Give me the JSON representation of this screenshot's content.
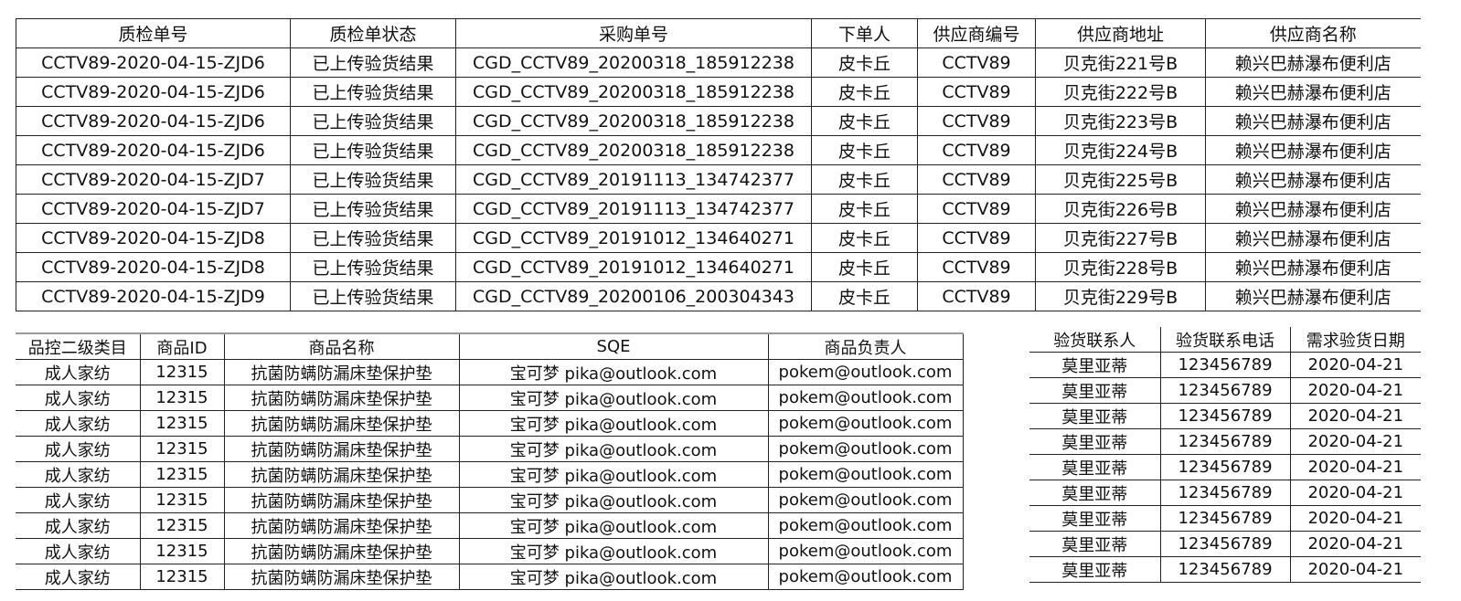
{
  "table1": {
    "headers": [
      "质检单号",
      "质检单状态",
      "采购单号",
      "下单人",
      "供应商编号",
      "供应商地址",
      "供应商名称"
    ],
    "rows": [
      [
        "CCTV89-2020-04-15-ZJD6",
        "已上传验货结果",
        "CGD_CCTV89_20200318_185912238",
        "皮卡丘",
        "CCTV89",
        "贝克街221号B",
        "赖兴巴赫瀑布便利店"
      ],
      [
        "CCTV89-2020-04-15-ZJD6",
        "已上传验货结果",
        "CGD_CCTV89_20200318_185912238",
        "皮卡丘",
        "CCTV89",
        "贝克街222号B",
        "赖兴巴赫瀑布便利店"
      ],
      [
        "CCTV89-2020-04-15-ZJD6",
        "已上传验货结果",
        "CGD_CCTV89_20200318_185912238",
        "皮卡丘",
        "CCTV89",
        "贝克街223号B",
        "赖兴巴赫瀑布便利店"
      ],
      [
        "CCTV89-2020-04-15-ZJD6",
        "已上传验货结果",
        "CGD_CCTV89_20200318_185912238",
        "皮卡丘",
        "CCTV89",
        "贝克街224号B",
        "赖兴巴赫瀑布便利店"
      ],
      [
        "CCTV89-2020-04-15-ZJD7",
        "已上传验货结果",
        "CGD_CCTV89_20191113_134742377",
        "皮卡丘",
        "CCTV89",
        "贝克街225号B",
        "赖兴巴赫瀑布便利店"
      ],
      [
        "CCTV89-2020-04-15-ZJD7",
        "已上传验货结果",
        "CGD_CCTV89_20191113_134742377",
        "皮卡丘",
        "CCTV89",
        "贝克街226号B",
        "赖兴巴赫瀑布便利店"
      ],
      [
        "CCTV89-2020-04-15-ZJD8",
        "已上传验货结果",
        "CGD_CCTV89_20191012_134640271",
        "皮卡丘",
        "CCTV89",
        "贝克街227号B",
        "赖兴巴赫瀑布便利店"
      ],
      [
        "CCTV89-2020-04-15-ZJD8",
        "已上传验货结果",
        "CGD_CCTV89_20191012_134640271",
        "皮卡丘",
        "CCTV89",
        "贝克街228号B",
        "赖兴巴赫瀑布便利店"
      ],
      [
        "CCTV89-2020-04-15-ZJD9",
        "已上传验货结果",
        "CGD_CCTV89_20200106_200304343",
        "皮卡丘",
        "CCTV89",
        "贝克街229号B",
        "赖兴巴赫瀑布便利店"
      ]
    ]
  },
  "table2": {
    "headers": [
      "品控二级类目",
      "商品ID",
      "商品名称",
      "SQE",
      "商品负责人"
    ],
    "rows": [
      [
        "成人家纺",
        "12315",
        "抗菌防螨防漏床垫保护垫",
        "宝可梦 pika@outlook.com",
        "pokem@outlook.com"
      ],
      [
        "成人家纺",
        "12315",
        "抗菌防螨防漏床垫保护垫",
        "宝可梦 pika@outlook.com",
        "pokem@outlook.com"
      ],
      [
        "成人家纺",
        "12315",
        "抗菌防螨防漏床垫保护垫",
        "宝可梦 pika@outlook.com",
        "pokem@outlook.com"
      ],
      [
        "成人家纺",
        "12315",
        "抗菌防螨防漏床垫保护垫",
        "宝可梦 pika@outlook.com",
        "pokem@outlook.com"
      ],
      [
        "成人家纺",
        "12315",
        "抗菌防螨防漏床垫保护垫",
        "宝可梦 pika@outlook.com",
        "pokem@outlook.com"
      ],
      [
        "成人家纺",
        "12315",
        "抗菌防螨防漏床垫保护垫",
        "宝可梦 pika@outlook.com",
        "pokem@outlook.com"
      ],
      [
        "成人家纺",
        "12315",
        "抗菌防螨防漏床垫保护垫",
        "宝可梦 pika@outlook.com",
        "pokem@outlook.com"
      ],
      [
        "成人家纺",
        "12315",
        "抗菌防螨防漏床垫保护垫",
        "宝可梦 pika@outlook.com",
        "pokem@outlook.com"
      ],
      [
        "成人家纺",
        "12315",
        "抗菌防螨防漏床垫保护垫",
        "宝可梦 pika@outlook.com",
        "pokem@outlook.com"
      ]
    ]
  },
  "table3": {
    "headers": [
      "验货联系人",
      "验货联系电话",
      "需求验货日期"
    ],
    "rows": [
      [
        "莫里亚蒂",
        "123456789",
        "2020-04-21"
      ],
      [
        "莫里亚蒂",
        "123456789",
        "2020-04-21"
      ],
      [
        "莫里亚蒂",
        "123456789",
        "2020-04-21"
      ],
      [
        "莫里亚蒂",
        "123456789",
        "2020-04-21"
      ],
      [
        "莫里亚蒂",
        "123456789",
        "2020-04-21"
      ],
      [
        "莫里亚蒂",
        "123456789",
        "2020-04-21"
      ],
      [
        "莫里亚蒂",
        "123456789",
        "2020-04-21"
      ],
      [
        "莫里亚蒂",
        "123456789",
        "2020-04-21"
      ],
      [
        "莫里亚蒂",
        "123456789",
        "2020-04-21"
      ]
    ]
  }
}
